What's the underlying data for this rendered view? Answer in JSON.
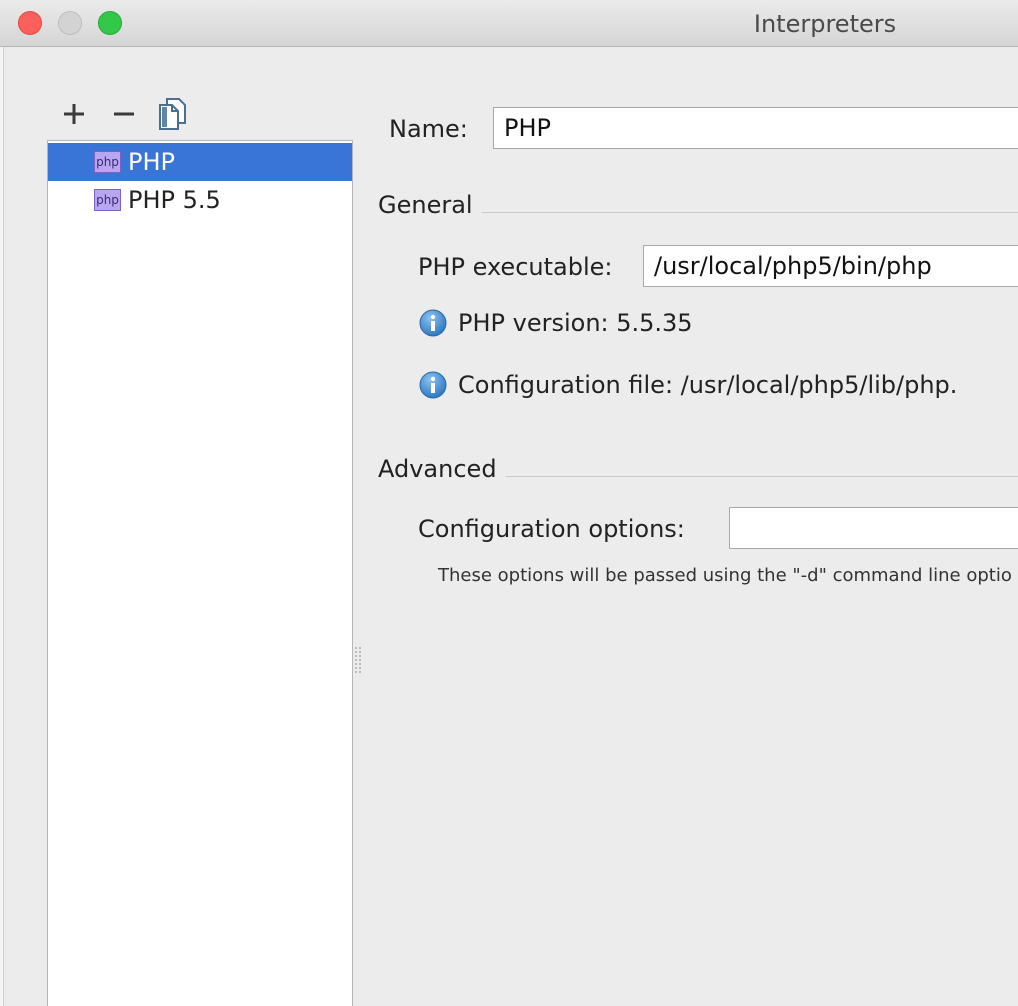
{
  "window": {
    "title": "Interpreters"
  },
  "toolbar": {
    "add_label": "+",
    "remove_label": "−"
  },
  "interpreters": {
    "items": [
      {
        "label": "PHP",
        "icon_text": "php",
        "selected": true
      },
      {
        "label": "PHP 5.5",
        "icon_text": "php",
        "selected": false
      }
    ]
  },
  "form": {
    "name_label": "Name:",
    "name_value": "PHP",
    "general_section": "General",
    "executable_label": "PHP executable:",
    "executable_value": "/usr/local/php5/bin/php",
    "php_version_text": "PHP version: 5.5.35",
    "config_file_text": "Configuration file: /usr/local/php5/lib/php.",
    "advanced_section": "Advanced",
    "config_options_label": "Configuration options:",
    "config_options_value": "",
    "config_options_hint": "These options will be passed using the \"-d\" command line optio"
  },
  "colors": {
    "selection": "#3875d7",
    "info_icon": "#3a87cf",
    "php_icon_bg": "#b9a6f2"
  },
  "icons": {
    "add": "plus-icon",
    "remove": "minus-icon",
    "copy": "copy-icon",
    "info": "info-icon",
    "php": "php-file-icon"
  }
}
